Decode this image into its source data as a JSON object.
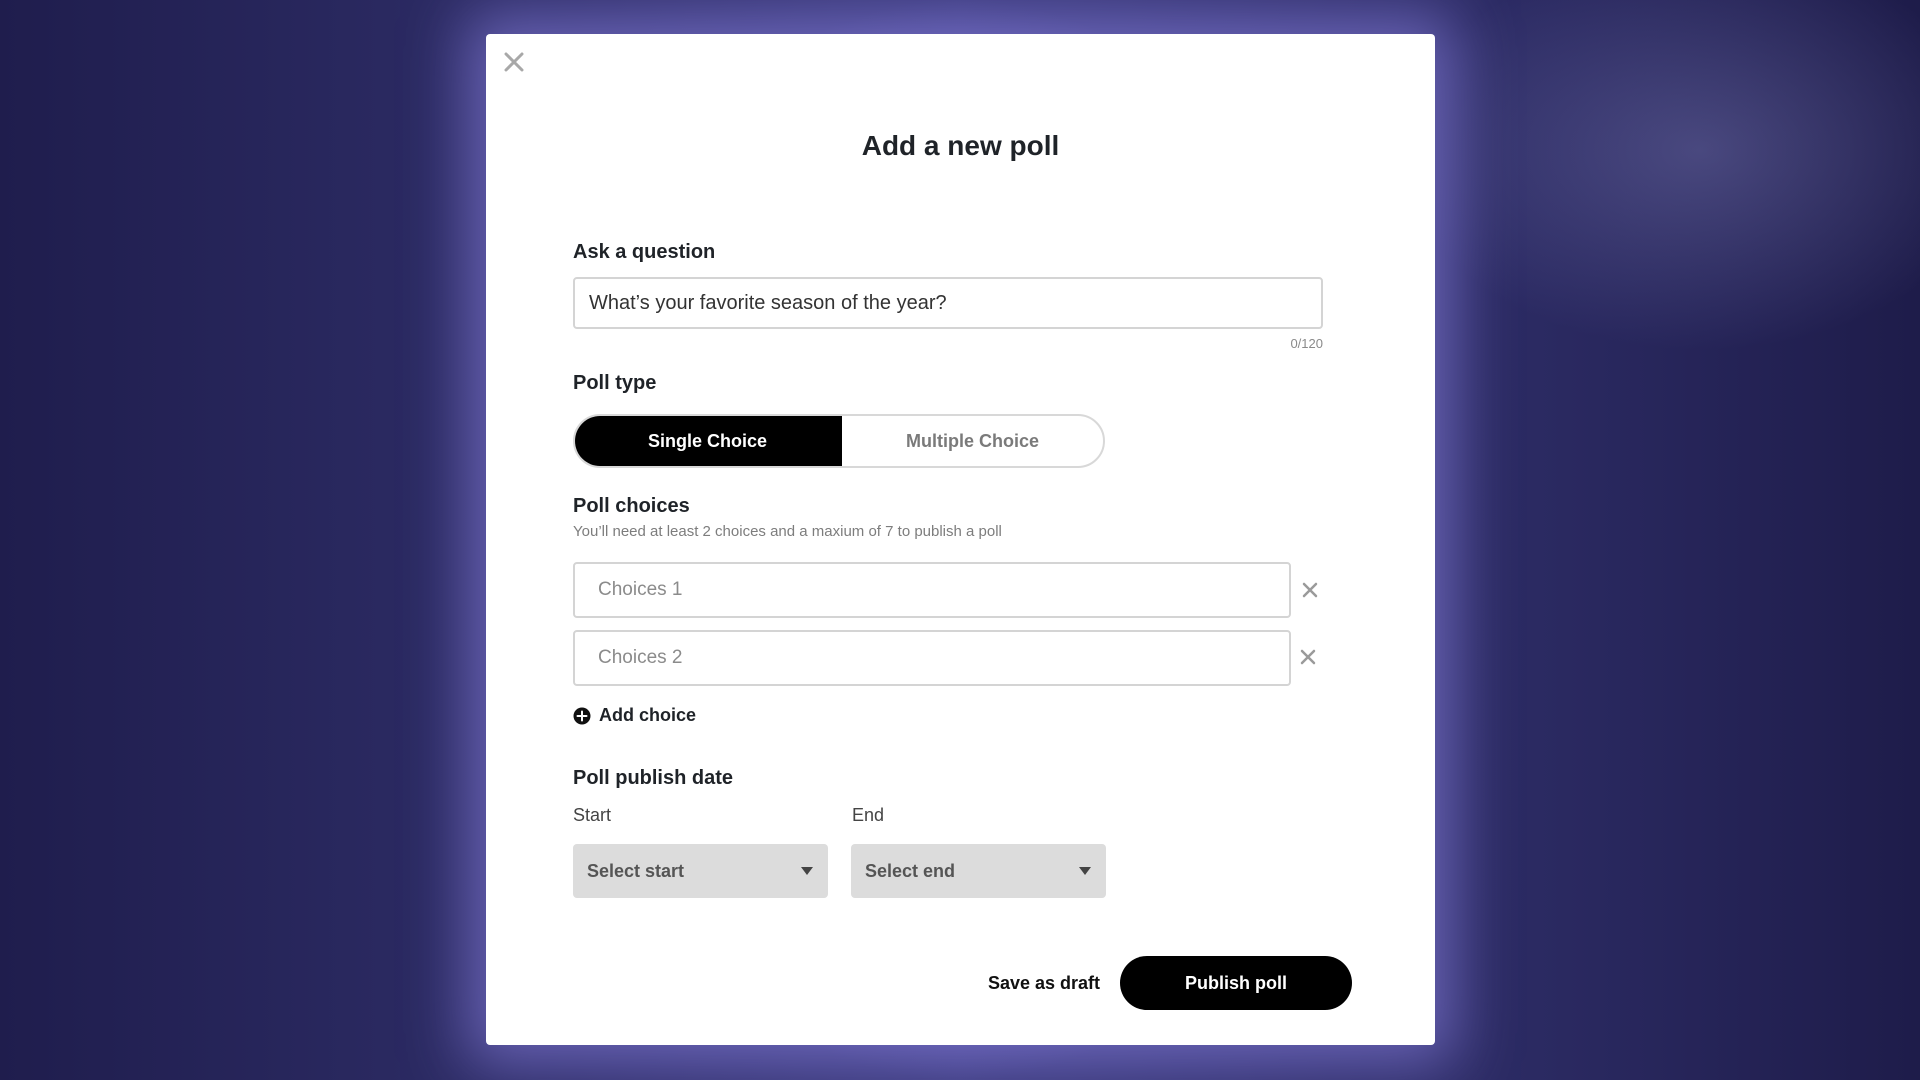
{
  "dialog": {
    "title": "Add a new poll"
  },
  "question": {
    "label": "Ask a question",
    "value": "What’s your favorite season of the year?",
    "counter": "0/120"
  },
  "poll_type": {
    "label": "Poll type",
    "options": [
      "Single Choice",
      "Multiple Choice"
    ],
    "selected": "Single Choice"
  },
  "choices": {
    "label": "Poll choices",
    "helper": "You’ll need at least 2 choices and a maxium of 7 to publish a poll",
    "items": [
      {
        "placeholder": "Choices 1"
      },
      {
        "placeholder": "Choices 2"
      }
    ],
    "add_label": "Add choice"
  },
  "publish_date": {
    "label": "Poll publish date",
    "start_label": "Start",
    "start_placeholder": "Select start",
    "end_label": "End",
    "end_placeholder": "Select end"
  },
  "actions": {
    "draft_label": "Save as draft",
    "publish_label": "Publish poll"
  },
  "colors": {
    "primary": "#000000",
    "field_border": "#d4d4d4",
    "select_bg": "#dcdcdc",
    "backdrop": "#2a2960"
  },
  "icons": {
    "close": "close-icon",
    "remove": "close-icon",
    "add": "plus-circle-icon",
    "dropdown": "caret-down-icon"
  }
}
